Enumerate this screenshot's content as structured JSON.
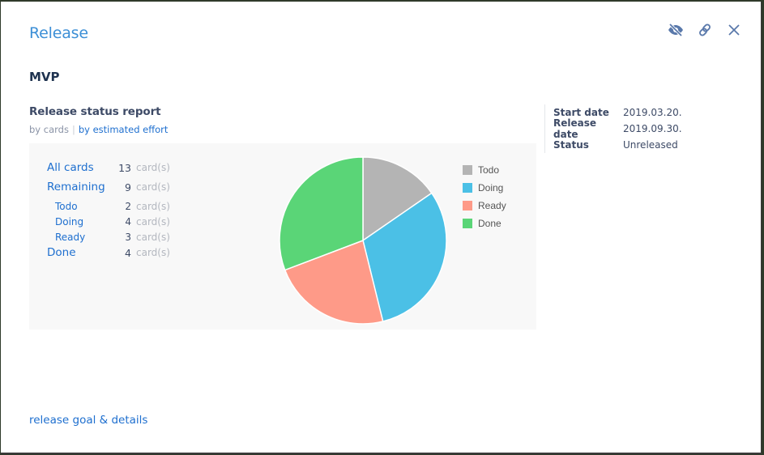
{
  "modal": {
    "title": "Release",
    "icons": [
      "eye-slash-icon",
      "link-icon",
      "close-icon"
    ]
  },
  "release": {
    "name": "MVP"
  },
  "report": {
    "title": "Release status report",
    "mode_by_cards": "by cards",
    "mode_separator": "|",
    "mode_by_effort": "by estimated effort",
    "unit": "card(s)",
    "stats": [
      {
        "label": "All cards",
        "value": "13",
        "level": "main"
      },
      {
        "label": "Remaining",
        "value": "9",
        "level": "main"
      },
      {
        "label": "Todo",
        "value": "2",
        "level": "sub"
      },
      {
        "label": "Doing",
        "value": "4",
        "level": "sub"
      },
      {
        "label": "Ready",
        "value": "3",
        "level": "sub"
      },
      {
        "label": "Done",
        "value": "4",
        "level": "main"
      }
    ]
  },
  "info": {
    "rows": [
      {
        "key": "Start date",
        "value": "2019.03.20."
      },
      {
        "key": "Release date",
        "value": "2019.09.30."
      },
      {
        "key": "Status",
        "value": "Unreleased"
      }
    ]
  },
  "footer": {
    "link": "release goal & details"
  },
  "chart_data": {
    "type": "pie",
    "title": "",
    "categories": [
      "Todo",
      "Doing",
      "Ready",
      "Done"
    ],
    "values": [
      2,
      4,
      3,
      4
    ],
    "colors": [
      "#b4b4b4",
      "#4bc0e6",
      "#fe9a88",
      "#5ad577"
    ],
    "start_angle": "top",
    "direction": "clockwise",
    "legend_position": "right"
  }
}
